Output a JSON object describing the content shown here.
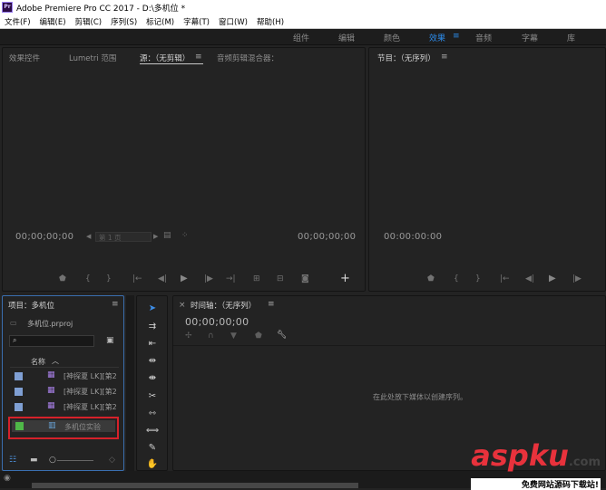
{
  "title": "Adobe Premiere Pro CC 2017 - D:\\多机位 *",
  "app_icon": "Pr",
  "menus": [
    "文件(F)",
    "编辑(E)",
    "剪辑(C)",
    "序列(S)",
    "标记(M)",
    "字幕(T)",
    "窗口(W)",
    "帮助(H)"
  ],
  "workspaces": [
    "组件",
    "编辑",
    "颜色",
    "效果",
    "音频",
    "字幕",
    "库"
  ],
  "active_workspace": "效果",
  "source_panel": {
    "tabs": [
      "效果控件",
      "Lumetri 范围",
      "源：（无剪辑）",
      "音频剪辑混合器："
    ],
    "active_tab": "源：（无剪辑）",
    "timecode_left": "00;00;00;00",
    "timecode_right": "00;00;00;00",
    "page_select": "第 1 页"
  },
  "program_panel": {
    "title": "节目：（无序列）",
    "timecode": "00:00:00:00"
  },
  "project_panel": {
    "title": "项目：多机位",
    "file": "多机位.prproj",
    "column_header": "名称",
    "items": [
      {
        "label": "[神探夏 LK][第2",
        "color": "#7f9fd3",
        "selected": false
      },
      {
        "label": "[神探夏 LK][第2",
        "color": "#7f9fd3",
        "selected": false
      },
      {
        "label": "[神探夏 LK][第2",
        "color": "#7f9fd3",
        "selected": false
      },
      {
        "label": "多机位实验",
        "color": "#4fb848",
        "selected": true
      }
    ]
  },
  "timeline_panel": {
    "title": "时间轴：（无序列）",
    "timecode": "00;00;00;00",
    "empty_message": "在此处放下媒体以创建序列。"
  },
  "watermark": {
    "brand": "aspku",
    "tld": ".com",
    "tagline": "免费网站源码下载站!"
  },
  "colors": {
    "accent": "#2d8ceb",
    "highlight_box": "#d6212a",
    "watermark_red": "#e8323c"
  }
}
